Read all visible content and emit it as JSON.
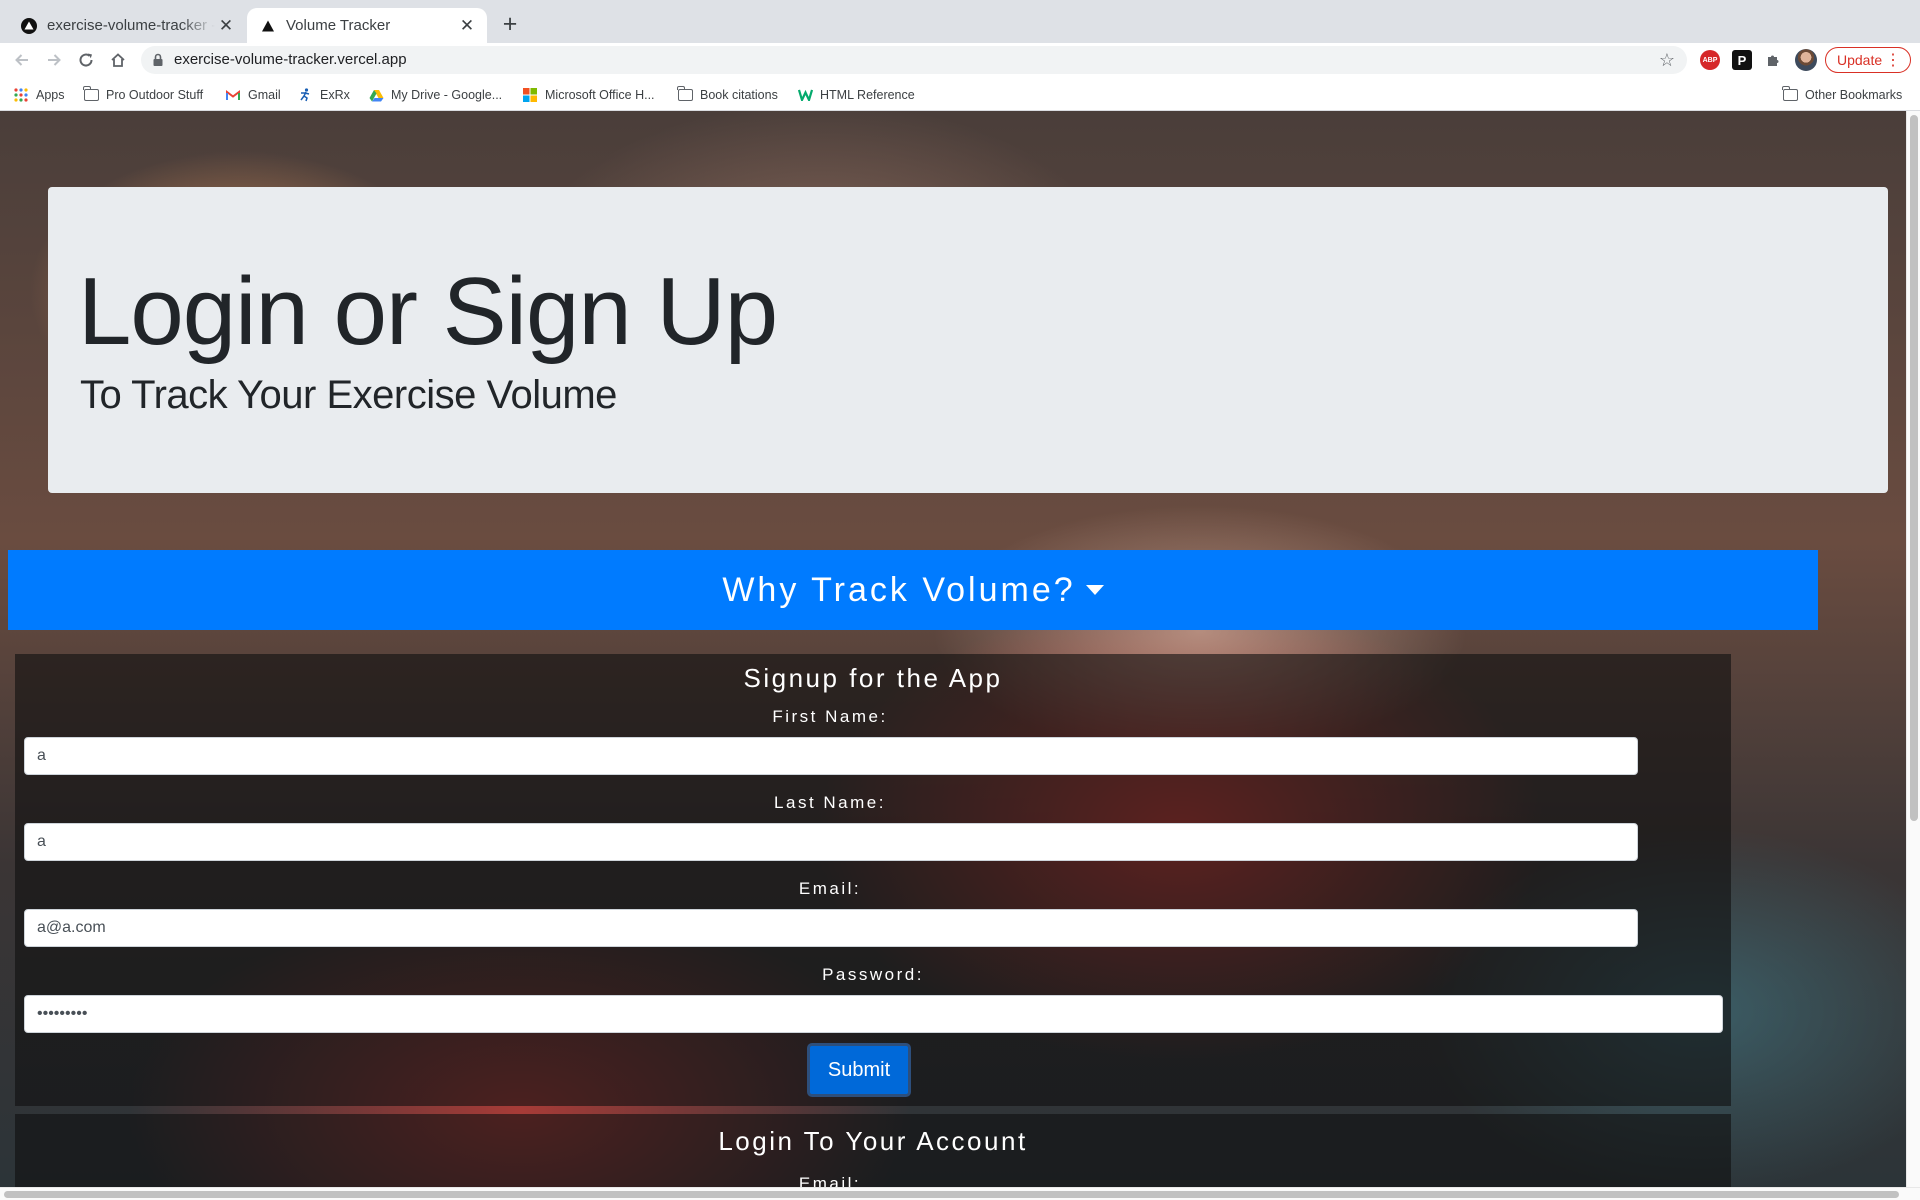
{
  "browser": {
    "tabs": [
      {
        "title": "exercise-volume-tracker - Overview",
        "active": false
      },
      {
        "title": "Volume Tracker",
        "active": true
      }
    ],
    "new_tab_glyph": "+",
    "url": "exercise-volume-tracker.vercel.app",
    "update_label": "Update",
    "bookmarks": [
      {
        "label": "Apps",
        "icon": "apps-grid-icon"
      },
      {
        "label": "Pro Outdoor Stuff",
        "icon": "folder-icon"
      },
      {
        "label": "Gmail",
        "icon": "gmail-icon"
      },
      {
        "label": "ExRx",
        "icon": "exrx-icon"
      },
      {
        "label": "My Drive - Google...",
        "icon": "google-drive-icon"
      },
      {
        "label": "Microsoft Office H...",
        "icon": "microsoft-office-icon"
      },
      {
        "label": "Book citations",
        "icon": "folder-icon"
      },
      {
        "label": "HTML Reference",
        "icon": "w3schools-icon"
      }
    ],
    "other_bookmarks": "Other Bookmarks",
    "extensions": {
      "abp": "ABP",
      "p": "P"
    }
  },
  "page": {
    "heading": "Login or Sign Up",
    "subheading": "To Track Your Exercise Volume",
    "why_button": "Why Track Volume?",
    "signup": {
      "title": "Signup for the App",
      "first_name_label": "First Name:",
      "first_name_value": "a",
      "last_name_label": "Last Name:",
      "last_name_value": "a",
      "email_label": "Email:",
      "email_value": "a@a.com",
      "password_label": "Password:",
      "password_value": "•••••••••",
      "submit_label": "Submit"
    },
    "login": {
      "title": "Login To Your Account",
      "email_label": "Email:"
    }
  },
  "colors": {
    "primary": "#007bff",
    "jumbotron": "#e9ecef",
    "update_red": "#d93025"
  }
}
